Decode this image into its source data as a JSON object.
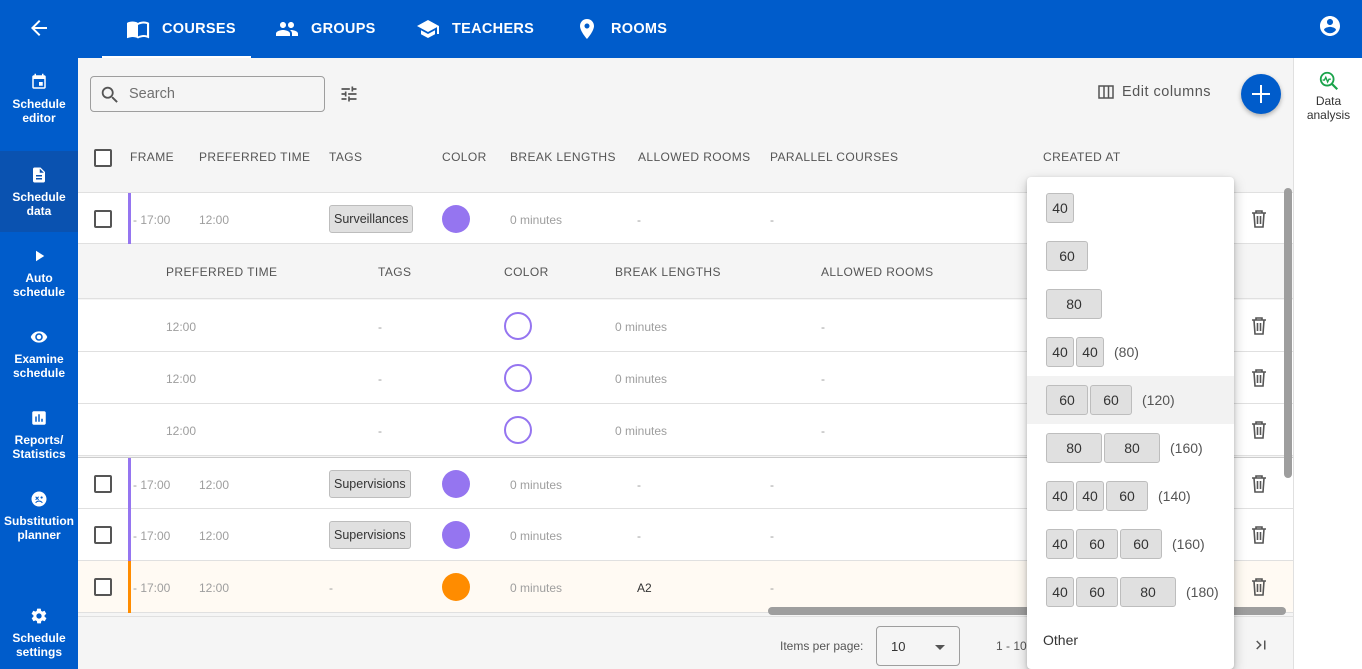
{
  "nav": {
    "tabs": [
      {
        "label": "COURSES",
        "icon": "book-open-icon",
        "active": true
      },
      {
        "label": "GROUPS",
        "icon": "people-icon"
      },
      {
        "label": "TEACHERS",
        "icon": "school-icon"
      },
      {
        "label": "ROOMS",
        "icon": "location-pin-icon"
      }
    ]
  },
  "sidebar": {
    "items": [
      {
        "label": "Schedule editor",
        "icon": "calendar-icon"
      },
      {
        "label": "Schedule data",
        "icon": "document-icon",
        "active": true
      },
      {
        "label": "Auto schedule",
        "icon": "play-icon"
      },
      {
        "label": "Examine schedule",
        "icon": "eye-icon"
      },
      {
        "label": "Reports/ Statistics",
        "icon": "bar-chart-icon"
      },
      {
        "label": "Substitution planner",
        "icon": "sick-face-icon"
      },
      {
        "label": "Schedule settings",
        "icon": "gear-icon"
      }
    ]
  },
  "rightbar": {
    "data_analysis_label": "Data analysis"
  },
  "toolbar": {
    "search_placeholder": "Search",
    "edit_columns_label": "Edit columns"
  },
  "table": {
    "headers": {
      "frame": "FRAME",
      "preferred_time": "PREFERRED TIME",
      "tags": "TAGS",
      "color": "COLOR",
      "break_lengths": "BREAK LENGTHS",
      "allowed_rooms": "ALLOWED ROOMS",
      "parallel_courses": "PARALLEL COURSES",
      "created_at": "CREATED AT"
    },
    "rows_top": [
      {
        "frame": "- 17:00",
        "preferred_time": "12:00",
        "tag": "Surveillances",
        "color": "#9575f0",
        "break_lengths": "0 minutes",
        "allowed_rooms": "-",
        "parallel": "-"
      }
    ],
    "sub_headers": {
      "preferred_time": "PREFERRED TIME",
      "tags": "TAGS",
      "color": "COLOR",
      "break_lengths": "BREAK LENGTHS",
      "allowed_rooms": "ALLOWED ROOMS"
    },
    "sub_rows": [
      {
        "preferred_time": "12:00",
        "tags": "-",
        "break_lengths": "0 minutes",
        "allowed_rooms": "-"
      },
      {
        "preferred_time": "12:00",
        "tags": "-",
        "break_lengths": "0 minutes",
        "allowed_rooms": "-"
      },
      {
        "preferred_time": "12:00",
        "tags": "-",
        "break_lengths": "0 minutes",
        "allowed_rooms": "-"
      }
    ],
    "rows_bottom": [
      {
        "frame": "- 17:00",
        "preferred_time": "12:00",
        "tag": "Supervisions",
        "color": "#9575f0",
        "break_lengths": "0 minutes",
        "allowed_rooms": "-",
        "parallel": "-"
      },
      {
        "frame": "- 17:00",
        "preferred_time": "12:00",
        "tag": "Supervisions",
        "color": "#9575f0",
        "break_lengths": "0 minutes",
        "allowed_rooms": "-",
        "parallel": "-"
      },
      {
        "frame": "- 17:00",
        "preferred_time": "12:00",
        "tag": "-",
        "color": "#ff8c00",
        "break_lengths": "0 minutes",
        "allowed_rooms": "A2",
        "parallel": "-"
      }
    ]
  },
  "footer": {
    "items_per_page_label": "Items per page:",
    "items_per_page_value": "10",
    "range_text": "1 - 10"
  },
  "break_dropdown": {
    "options": [
      {
        "chips": [
          "40"
        ],
        "total": ""
      },
      {
        "chips": [
          "60"
        ],
        "total": ""
      },
      {
        "chips": [
          "80"
        ],
        "total": ""
      },
      {
        "chips": [
          "40",
          "40"
        ],
        "total": "(80)"
      },
      {
        "chips": [
          "60",
          "60"
        ],
        "total": "(120)",
        "highlighted": true
      },
      {
        "chips": [
          "80",
          "80"
        ],
        "total": "(160)"
      },
      {
        "chips": [
          "40",
          "40",
          "60"
        ],
        "total": "(140)"
      },
      {
        "chips": [
          "40",
          "60",
          "60"
        ],
        "total": "(160)"
      },
      {
        "chips": [
          "40",
          "60",
          "80"
        ],
        "total": "(180)"
      }
    ],
    "other_label": "Other"
  }
}
